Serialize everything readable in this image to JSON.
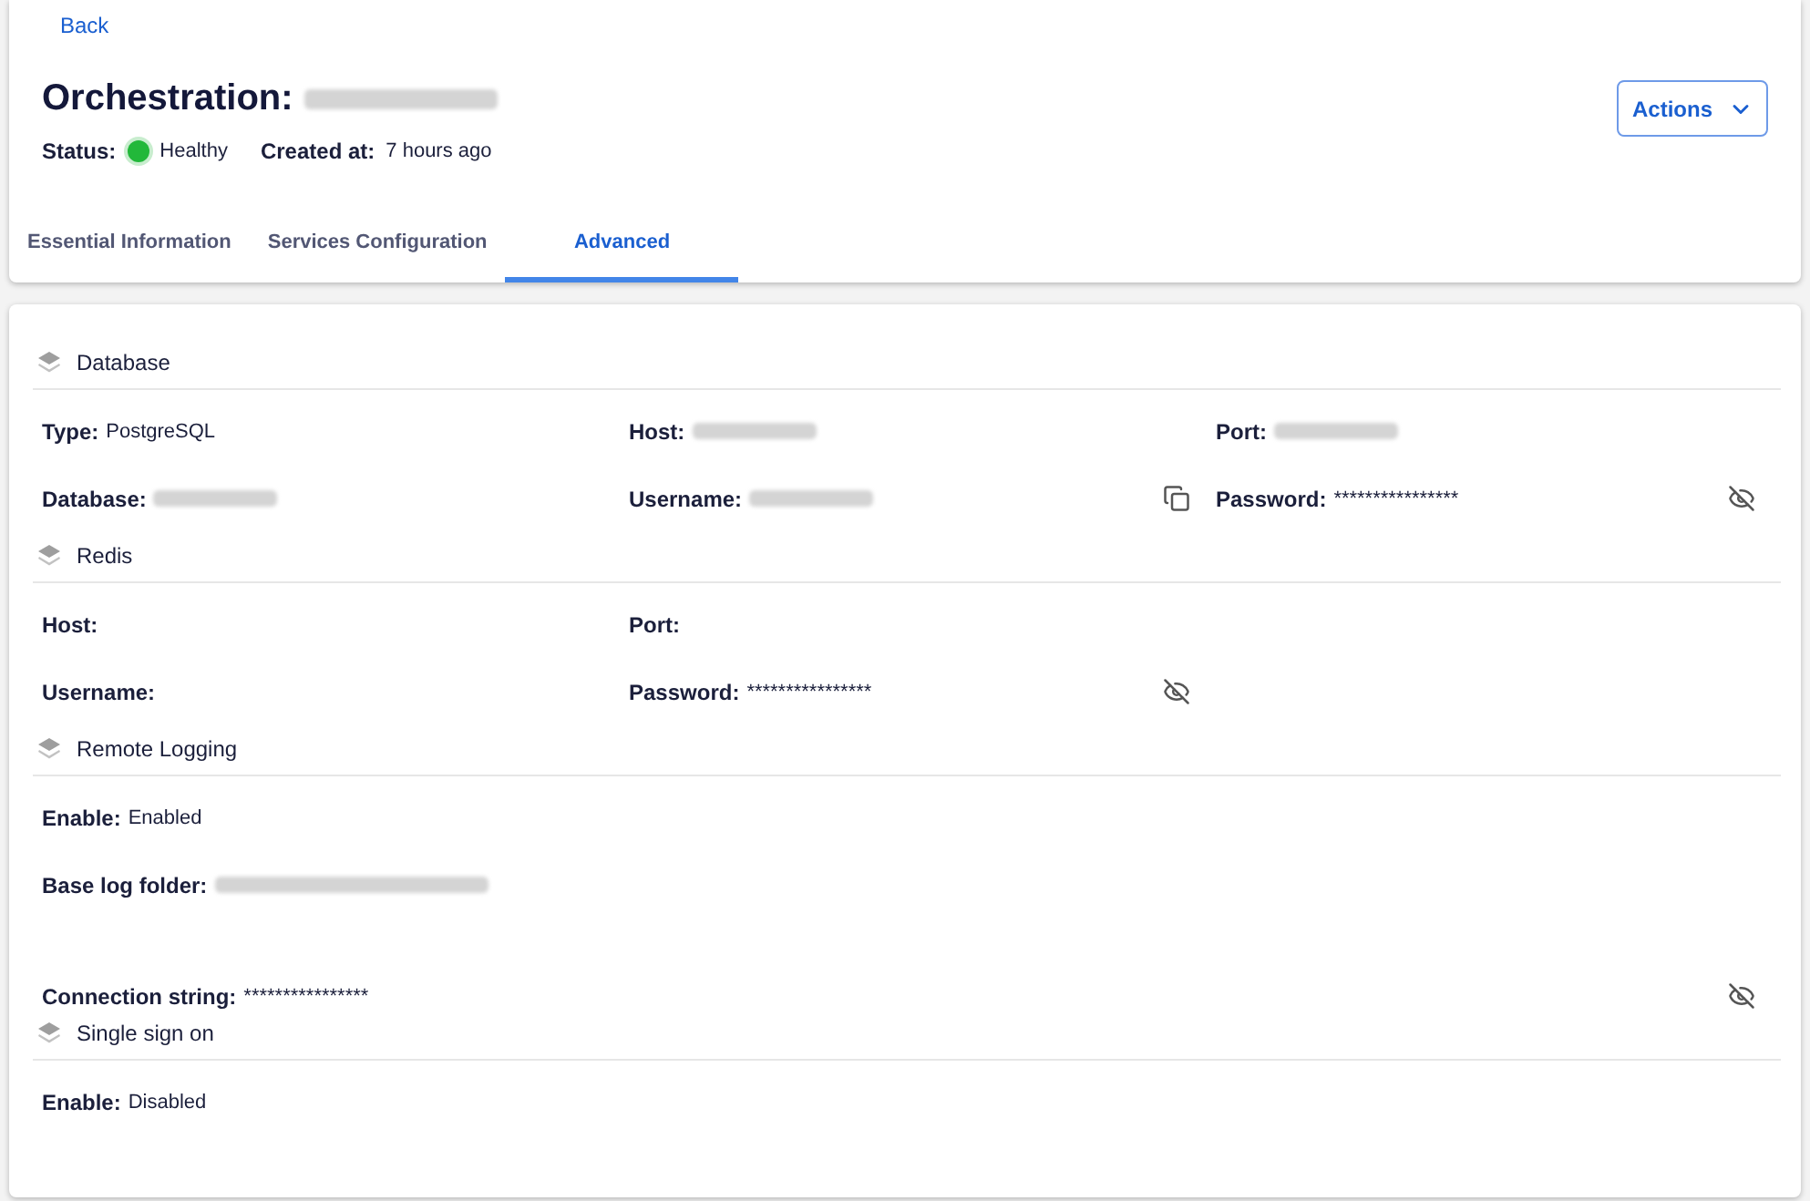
{
  "back_link": "Back",
  "title": {
    "label": "Orchestration:",
    "name_redacted": true
  },
  "meta": [
    {
      "kind": "status",
      "label": "Status:",
      "value": "Healthy",
      "color": "#22b83a"
    },
    {
      "kind": "text",
      "label": "Created at:",
      "value": "7 hours ago"
    }
  ],
  "actions_button": "Actions",
  "tabs": [
    {
      "label": "Essential Information",
      "selected": false
    },
    {
      "label": "Services Configuration",
      "selected": false
    },
    {
      "label": "Advanced",
      "selected": true
    }
  ],
  "sections": [
    {
      "title": "Database",
      "rows": [
        [
          {
            "kind": "plain",
            "label": "Type:",
            "value": "PostgreSQL"
          },
          {
            "kind": "plain",
            "label": "Host:",
            "redacted": true
          },
          {
            "kind": "plain",
            "label": "Port:",
            "redacted": true
          }
        ],
        [
          {
            "kind": "plain",
            "label": "Database:",
            "redacted": true
          },
          {
            "kind": "copy",
            "label": "Username:",
            "redacted": true
          },
          {
            "kind": "secret",
            "label": "Password:",
            "value": "****************"
          }
        ]
      ]
    },
    {
      "title": "Redis",
      "rows": [
        [
          {
            "kind": "plain",
            "label": "Host:"
          },
          {
            "kind": "plain",
            "label": "Port:"
          }
        ],
        [
          {
            "kind": "plain",
            "label": "Username:"
          },
          {
            "kind": "secret",
            "label": "Password:",
            "value": "****************"
          }
        ]
      ]
    },
    {
      "title": "Remote Logging",
      "rows": [
        [
          {
            "kind": "plain",
            "label": "Enable:",
            "value": "Enabled"
          }
        ],
        [
          {
            "kind": "plain",
            "label": "Base log folder:",
            "redacted": true
          }
        ],
        [
          {
            "kind": "secret",
            "label": "Connection string:",
            "value": "****************"
          }
        ]
      ]
    },
    {
      "title": "Single sign on",
      "rows": [
        [
          {
            "kind": "plain",
            "label": "Enable:",
            "value": "Disabled"
          }
        ]
      ]
    }
  ]
}
